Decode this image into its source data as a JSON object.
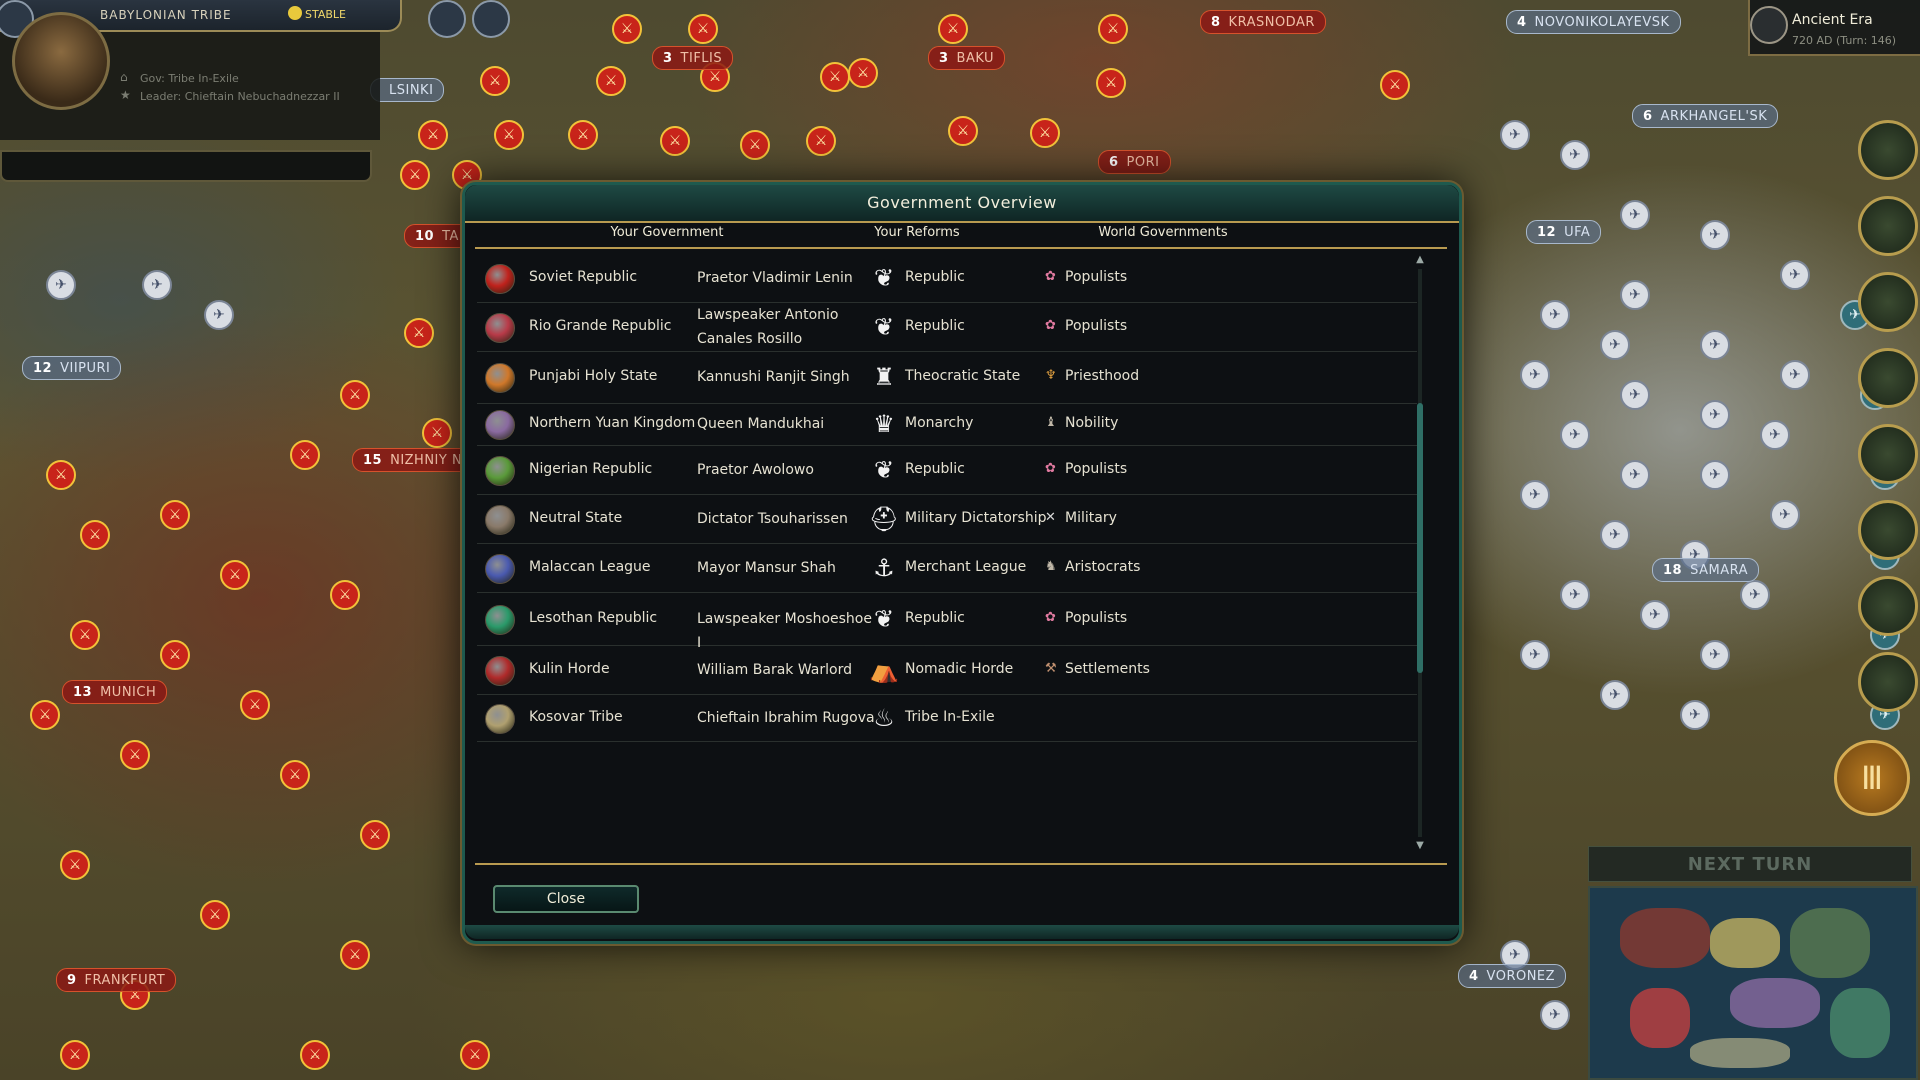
{
  "top_left": {
    "civ_name": "BABYLONIAN TRIBE",
    "status": "STABLE",
    "gov_line": "Gov: Tribe In-Exile",
    "leader_line": "Leader: Chieftain Nebuchadnezzar II"
  },
  "top_right": {
    "era": "Ancient Era",
    "turn_info": "720 AD (Turn: 146)"
  },
  "map_banners": [
    {
      "num": "3",
      "name": "TIFLIS"
    },
    {
      "num": "3",
      "name": "BAKU"
    },
    {
      "num": "8",
      "name": "KRASNODAR"
    },
    {
      "num": "4",
      "name": "NOVONIKOLAYEVSK"
    },
    {
      "num": "6",
      "name": "ARKHANGEL'SK"
    },
    {
      "num": "6",
      "name": "PORI"
    },
    {
      "num": "12",
      "name": "UFA"
    },
    {
      "num": "12",
      "name": "VIIPURI"
    },
    {
      "num": "15",
      "name": "NIZHNIY N"
    },
    {
      "num": "13",
      "name": "MUNICH"
    },
    {
      "num": "18",
      "name": "SAMARA"
    },
    {
      "num": "9",
      "name": "FRANKFURT"
    },
    {
      "num": "4",
      "name": "VORONEZ"
    },
    {
      "num": "10",
      "name": "TAL"
    },
    {
      "num": "",
      "name": "LSINKI"
    }
  ],
  "next_turn": "NEXT TURN",
  "dialog": {
    "title": "Government Overview",
    "tabs": [
      "Your Government",
      "Your Reforms",
      "World Governments"
    ],
    "rows": [
      {
        "civ": "Soviet Republic",
        "leader": "Praetor Vladimir Lenin",
        "gov_icon": "laurel-icon",
        "government": "Republic",
        "faction_icon": "populists-icon",
        "faction": "Populists",
        "emblem_color": "#c0221c"
      },
      {
        "civ": "Rio Grande Republic",
        "leader": "Lawspeaker Antonio Canales Rosillo",
        "gov_icon": "laurel-icon",
        "government": "Republic",
        "faction_icon": "populists-icon",
        "faction": "Populists",
        "emblem_color": "#b83a48"
      },
      {
        "civ": "Punjabi Holy State",
        "leader": "Kannushi Ranjit Singh",
        "gov_icon": "temple-icon",
        "government": "Theocratic State",
        "faction_icon": "priesthood-icon",
        "faction": "Priesthood",
        "emblem_color": "#d0782a"
      },
      {
        "civ": "Northern Yuan Kingdom",
        "leader": "Queen Mandukhai",
        "gov_icon": "crown-icon",
        "government": "Monarchy",
        "faction_icon": "nobility-icon",
        "faction": "Nobility",
        "emblem_color": "#8a6aa0"
      },
      {
        "civ": "Nigerian Republic",
        "leader": "Praetor Awolowo",
        "gov_icon": "laurel-icon",
        "government": "Republic",
        "faction_icon": "populists-icon",
        "faction": "Populists",
        "emblem_color": "#5a9a3a"
      },
      {
        "civ": "Neutral State",
        "leader": "Dictator Tsouharissen",
        "gov_icon": "helmet-icon",
        "government": "Military Dictatorship",
        "faction_icon": "military-icon",
        "faction": "Military",
        "emblem_color": "#8a7a6a"
      },
      {
        "civ": "Malaccan League",
        "leader": "Mayor Mansur Shah",
        "gov_icon": "merchant-icon",
        "government": "Merchant League",
        "faction_icon": "aristocrats-icon",
        "faction": "Aristocrats",
        "emblem_color": "#4a5ab0"
      },
      {
        "civ": "Lesothan Republic",
        "leader": "Lawspeaker Moshoeshoe I",
        "gov_icon": "laurel-icon",
        "government": "Republic",
        "faction_icon": "populists-icon",
        "faction": "Populists",
        "emblem_color": "#2a9a6a"
      },
      {
        "civ": "Kulin Horde",
        "leader": "William Barak Warlord",
        "gov_icon": "tent-icon",
        "government": "Nomadic Horde",
        "faction_icon": "settlements-icon",
        "faction": "Settlements",
        "emblem_color": "#b02a2a"
      },
      {
        "civ": "Kosovar Tribe",
        "leader": "Chieftain Ibrahim Rugova",
        "gov_icon": "campfire-icon",
        "government": "Tribe In-Exile",
        "faction_icon": "",
        "faction": "",
        "emblem_color": "#b0a070"
      }
    ],
    "close_label": "Close"
  }
}
